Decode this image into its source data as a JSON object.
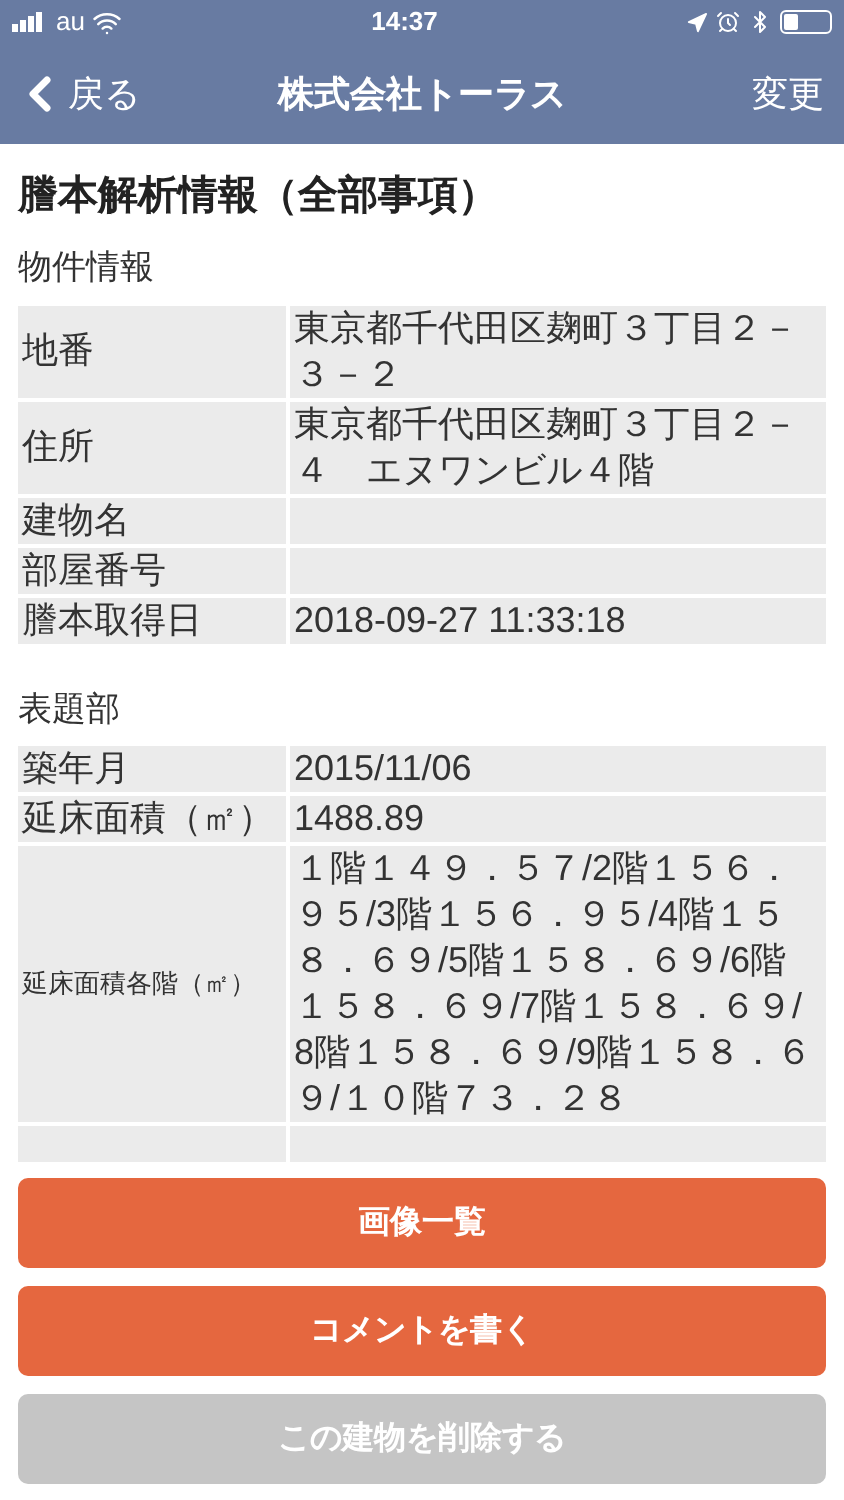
{
  "status_bar": {
    "carrier": "au",
    "time": "14:37",
    "battery": {
      "level": 0.3
    }
  },
  "nav": {
    "back": "戻る",
    "title": "株式会社トーラス",
    "action": "変更"
  },
  "page_title": "謄本解析情報（全部事項）",
  "sections": [
    {
      "title": "物件情報",
      "rows": [
        {
          "label": "地番",
          "value": "東京都千代田区麹町３丁目２－３－２"
        },
        {
          "label": "住所",
          "value": "東京都千代田区麹町３丁目２－４　エヌワンビル４階"
        },
        {
          "label": "建物名",
          "value": ""
        },
        {
          "label": "部屋番号",
          "value": ""
        },
        {
          "label": "謄本取得日",
          "value": "2018-09-27 11:33:18"
        }
      ]
    },
    {
      "title": "表題部",
      "rows": [
        {
          "label": "築年月",
          "value": "2015/11/06"
        },
        {
          "label": "延床面積（㎡）",
          "value": "1488.89"
        },
        {
          "label": "延床面積各階（㎡）",
          "value": "１階１４９．５７/2階１５６．９５/3階１５６．９５/4階１５８．６９/5階１５８．６９/6階１５８．６９/7階１５８．６９/8階１５８．６９/9階１５８．６９/１０階７３．２８",
          "small": true
        }
      ]
    }
  ],
  "buttons": [
    {
      "label": "画像一覧",
      "disabled": false
    },
    {
      "label": "コメントを書く",
      "disabled": false
    },
    {
      "label": "この建物を削除する",
      "disabled": true
    }
  ]
}
